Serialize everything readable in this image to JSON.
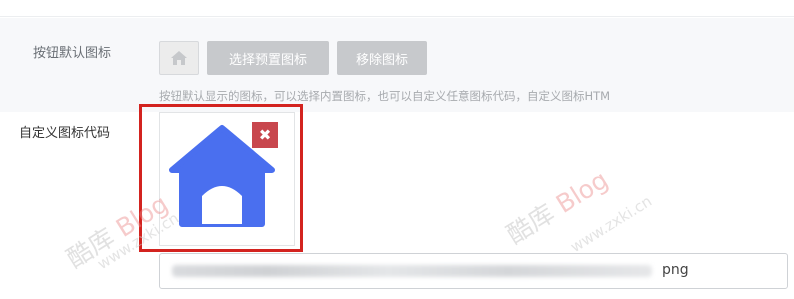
{
  "form": {
    "default_icon": {
      "label": "按钮默认图标",
      "preview_icon": "home-icon",
      "choose_button": "选择预置图标",
      "remove_button": "移除图标",
      "hint": "按钮默认显示的图标，可以选择内置图标，也可以自定义任意图标代码，自定义图标HTM"
    },
    "custom_icon": {
      "label": "自定义图标代码",
      "image_icon": "home-icon",
      "remove_icon": "close-icon",
      "url_visible_suffix": "png"
    }
  },
  "watermark": {
    "brand": "酷库",
    "brand_suffix": "Blog",
    "url": "www.zxki.cn"
  },
  "colors": {
    "icon_blue": "#4a6fef",
    "highlight_red": "#d3231f",
    "remove_red": "#c8464d",
    "button_gray": "#c7c9cc"
  }
}
